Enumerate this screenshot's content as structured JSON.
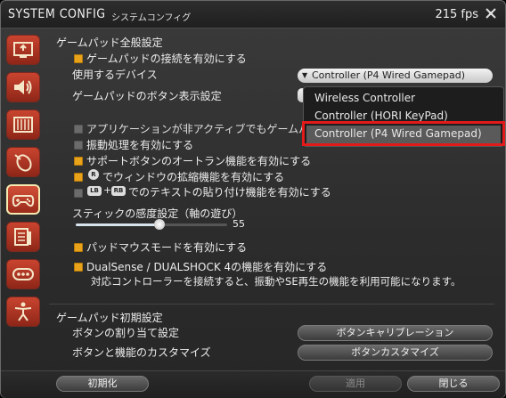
{
  "window": {
    "title": "SYSTEM CONFIG",
    "subtitle": "システムコンフィグ",
    "fps": "215 fps"
  },
  "sidebar": {
    "items": [
      {
        "name": "display-settings-icon"
      },
      {
        "name": "sound-settings-icon"
      },
      {
        "name": "hud-settings-icon"
      },
      {
        "name": "mouse-settings-icon"
      },
      {
        "name": "gamepad-settings-icon",
        "active": true
      },
      {
        "name": "log-window-icon"
      },
      {
        "name": "other-settings-icon"
      },
      {
        "name": "accessibility-icon"
      }
    ]
  },
  "gamepad": {
    "section_title": "ゲームパッド全般設定",
    "enable_connection": "ゲームパッドの接続を有効にする",
    "device_label": "使用するデバイス",
    "device_value": "Controller (P4 Wired Gamepad)",
    "button_display_label": "ゲームパッドのボタン表示設定",
    "dropdown_options": [
      "Wireless Controller",
      "Controller (HORI KeyPad)",
      "Controller (P4 Wired Gamepad)"
    ],
    "inactive_app": "アプリケーションが非アクティブでもゲームパ",
    "vibration": "振動処理を有効にする",
    "autorun": "サポートボタンのオートラン機能を有効にする",
    "window_scale_icon": "R",
    "window_scale": "でウィンドウの拡縮機能を有効にする",
    "paste_icon_lb": "LB",
    "paste_plus": "+",
    "paste_icon_rb": "RB",
    "paste_text": "でのテキストの貼り付け機能を有効にする",
    "stick_label": "スティックの感度設定（軸の遊び）",
    "stick_value": "55",
    "stick_fraction": 0.55,
    "pad_mouse": "パッドマウスモードを有効にする",
    "dualsense": "DualSense / DUALSHOCK 4の機能を有効にする",
    "dualsense_note": "対応コントローラーを接続すると、振動やSE再生の機能を利用可能になります。"
  },
  "initial": {
    "section_title": "ゲームパッド初期設定",
    "assign_label": "ボタンの割り当て設定",
    "assign_button": "ボタンキャリブレーション",
    "customize_label": "ボタンと機能のカスタマイズ",
    "customize_button": "ボタンカスタマイズ"
  },
  "footer": {
    "reset": "初期化",
    "apply": "適用",
    "close": "閉じる"
  },
  "colors": {
    "accent": "#e8a31a",
    "highlight_box": "#e21a1a",
    "sidebar": "#c9442f"
  }
}
